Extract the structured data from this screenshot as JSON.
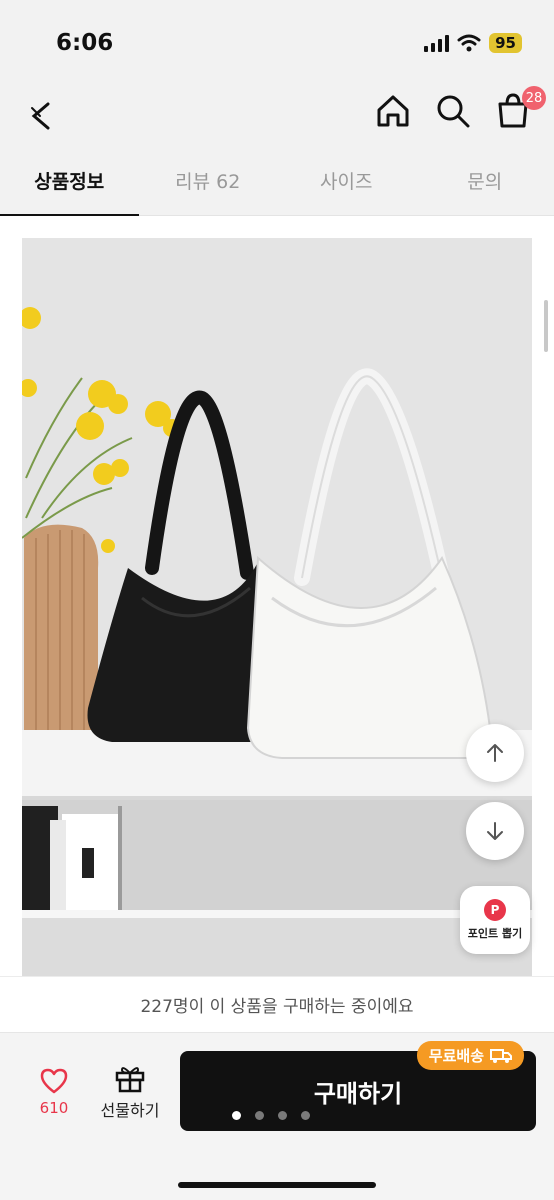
{
  "status_bar": {
    "time": "6:06",
    "battery": "95"
  },
  "nav": {
    "cart_count": "28"
  },
  "tabs": [
    {
      "label": "상품정보",
      "active": true
    },
    {
      "label": "리뷰 62",
      "active": false
    },
    {
      "label": "사이즈",
      "active": false
    },
    {
      "label": "문의",
      "active": false
    }
  ],
  "point_button": {
    "icon_letter": "P",
    "label": "포인트 뽑기"
  },
  "buyer_notice": "227명이 이 상품을 구매하는 중이에요",
  "bottom": {
    "like_count": "610",
    "gift_label": "선물하기",
    "buy_label": "구매하기",
    "free_shipping": "무료배송"
  },
  "colors": {
    "accent": "#e8364a",
    "badge": "#f59a23",
    "buy_button": "#111111"
  },
  "icons": [
    "back-icon",
    "home-icon",
    "search-icon",
    "bag-icon",
    "arrow-up-icon",
    "arrow-down-icon",
    "heart-icon",
    "gift-icon",
    "truck-icon"
  ]
}
